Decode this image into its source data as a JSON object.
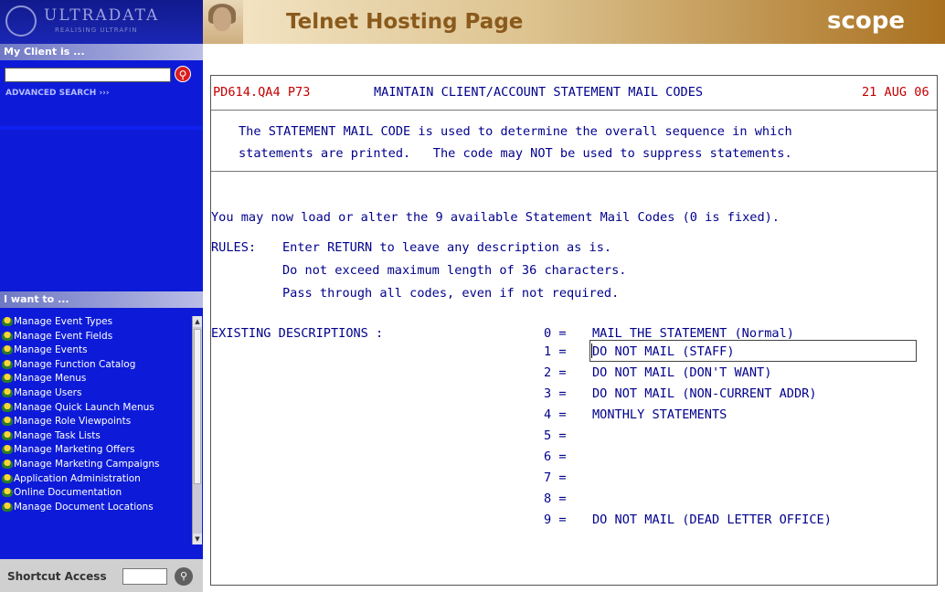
{
  "sidebar": {
    "logo": {
      "name": "ULTRADATA",
      "tagline": "REALISING ULTRAFIN"
    },
    "client_heading": "My Client is ...",
    "advanced_search": "ADVANCED SEARCH",
    "i_want_heading": "I want to ...",
    "menu_items": [
      "Manage Event Types",
      "Manage Event Fields",
      "Manage Events",
      "Manage Function Catalog",
      "Manage Menus",
      "Manage Users",
      "Manage Quick Launch Menus",
      "Manage Role Viewpoints",
      "Manage Task Lists",
      "Manage Marketing Offers",
      "Manage Marketing Campaigns",
      "Application Administration",
      "Online Documentation",
      "Manage Document Locations"
    ],
    "shortcut_label": "Shortcut Access"
  },
  "header": {
    "title": "Telnet Hosting Page",
    "brand": "scope"
  },
  "terminal": {
    "program_id": "PD614.QA4 P73",
    "screen_title": "MAINTAIN CLIENT/ACCOUNT STATEMENT MAIL CODES",
    "date": "21 AUG 06",
    "info_line1": "The STATEMENT MAIL CODE is used to determine the overall sequence in which",
    "info_line2": "statements are printed.   The code may NOT be used to suppress statements.",
    "prompt": "You may now load or alter the 9 available Statement Mail Codes (0 is fixed).",
    "rules_label": "RULES:",
    "rules": [
      "Enter RETURN to leave any description as is.",
      "Do not exceed maximum length of 36 characters.",
      "Pass through all codes, even if not required."
    ],
    "existing_label": "EXISTING DESCRIPTIONS :",
    "codes": [
      {
        "code": "0 =",
        "desc": "MAIL THE STATEMENT (Normal)"
      },
      {
        "code": "1 =",
        "desc": "DO NOT MAIL (STAFF)"
      },
      {
        "code": "2 =",
        "desc": "DO NOT MAIL (DON'T WANT)"
      },
      {
        "code": "3 =",
        "desc": "DO NOT MAIL (NON-CURRENT ADDR)"
      },
      {
        "code": "4 =",
        "desc": "MONTHLY STATEMENTS"
      },
      {
        "code": "5 =",
        "desc": ""
      },
      {
        "code": "6 =",
        "desc": ""
      },
      {
        "code": "7 =",
        "desc": ""
      },
      {
        "code": "8 =",
        "desc": ""
      },
      {
        "code": "9 =",
        "desc": "DO NOT MAIL (DEAD LETTER OFFICE)"
      }
    ]
  }
}
